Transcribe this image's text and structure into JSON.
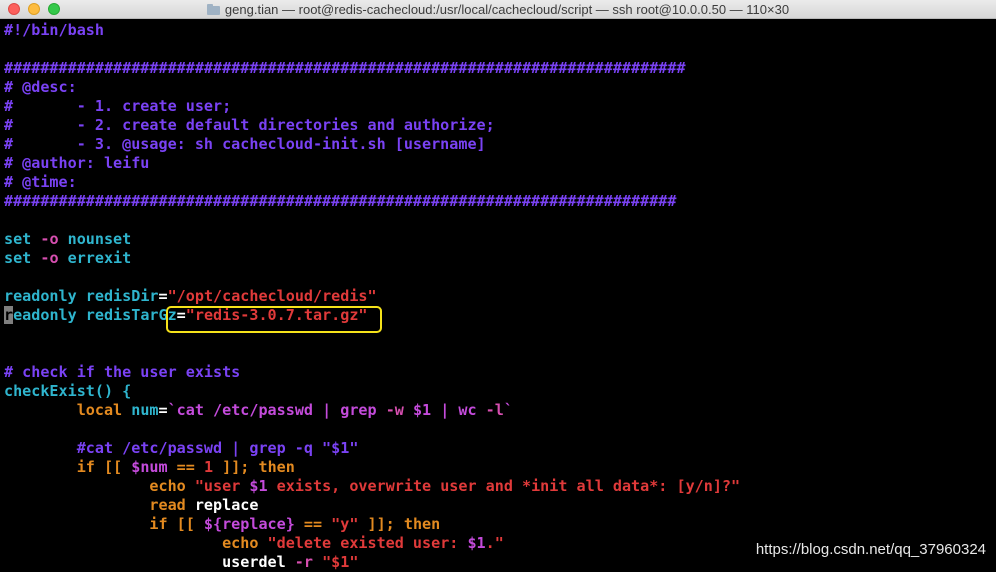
{
  "window": {
    "title": "geng.tian — root@redis-cachecloud:/usr/local/cachecloud/script — ssh root@10.0.0.50 — 110×30"
  },
  "terminal": {
    "lines": [
      [
        {
          "t": "#!/bin/bash",
          "c": "c-comment"
        }
      ],
      [],
      [
        {
          "t": "###########################################################################",
          "c": "c-comment"
        }
      ],
      [
        {
          "t": "# @desc:",
          "c": "c-comment"
        }
      ],
      [
        {
          "t": "#       - 1. create user;",
          "c": "c-comment"
        }
      ],
      [
        {
          "t": "#       - 2. create default directories and authorize;",
          "c": "c-comment"
        }
      ],
      [
        {
          "t": "#       - 3. @usage: sh cachecloud-init.sh [username]",
          "c": "c-comment"
        }
      ],
      [
        {
          "t": "# @author: leifu",
          "c": "c-comment"
        }
      ],
      [
        {
          "t": "# @time:",
          "c": "c-comment"
        }
      ],
      [
        {
          "t": "##########################################################################",
          "c": "c-comment"
        }
      ],
      [],
      [
        {
          "t": "set ",
          "c": "c-kw"
        },
        {
          "t": "-o ",
          "c": "c-opt"
        },
        {
          "t": "nounset",
          "c": "c-kw"
        }
      ],
      [
        {
          "t": "set ",
          "c": "c-kw"
        },
        {
          "t": "-o ",
          "c": "c-opt"
        },
        {
          "t": "errexit",
          "c": "c-kw"
        }
      ],
      [],
      [
        {
          "t": "readonly ",
          "c": "c-kw"
        },
        {
          "t": "redisDir",
          "c": "c-kw"
        },
        {
          "t": "=",
          "c": "c-txt"
        },
        {
          "t": "\"/opt/cachecloud/redis\"",
          "c": "c-str"
        }
      ],
      [
        {
          "t": "r",
          "c": "cursor"
        },
        {
          "t": "eadonly ",
          "c": "c-kw"
        },
        {
          "t": "redisTarGz",
          "c": "c-kw"
        },
        {
          "t": "=",
          "c": "c-txt"
        },
        {
          "t": "\"redis-3.0.7.tar.gz\"",
          "c": "c-str"
        }
      ],
      [],
      [],
      [
        {
          "t": "# check if the user exists",
          "c": "c-comment"
        }
      ],
      [
        {
          "t": "checkExist() {",
          "c": "c-kw"
        }
      ],
      [
        {
          "t": "        local ",
          "c": "c-or"
        },
        {
          "t": "num",
          "c": "c-kw"
        },
        {
          "t": "=",
          "c": "c-txt"
        },
        {
          "t": "`cat /etc/passwd | grep ",
          "c": "c-var"
        },
        {
          "t": "-w ",
          "c": "c-opt"
        },
        {
          "t": "$1",
          "c": "c-var"
        },
        {
          "t": " | wc ",
          "c": "c-var"
        },
        {
          "t": "-l",
          "c": "c-opt"
        },
        {
          "t": "`",
          "c": "c-var"
        }
      ],
      [],
      [
        {
          "t": "        #cat /etc/passwd | grep -q \"$1\"",
          "c": "c-comment"
        }
      ],
      [
        {
          "t": "        if [[ ",
          "c": "c-or"
        },
        {
          "t": "$num",
          "c": "c-var"
        },
        {
          "t": " == ",
          "c": "c-or"
        },
        {
          "t": "1",
          "c": "c-str"
        },
        {
          "t": " ]]; then",
          "c": "c-or"
        }
      ],
      [
        {
          "t": "                echo ",
          "c": "c-or"
        },
        {
          "t": "\"user ",
          "c": "c-str"
        },
        {
          "t": "$1",
          "c": "c-var"
        },
        {
          "t": " exists, overwrite user and *init all data*: [y/n]?\"",
          "c": "c-str"
        }
      ],
      [
        {
          "t": "                read ",
          "c": "c-or"
        },
        {
          "t": "replace",
          "c": "c-txt"
        }
      ],
      [
        {
          "t": "                if [[ ",
          "c": "c-or"
        },
        {
          "t": "${replace}",
          "c": "c-var"
        },
        {
          "t": " == ",
          "c": "c-or"
        },
        {
          "t": "\"y\"",
          "c": "c-str"
        },
        {
          "t": " ]]; then",
          "c": "c-or"
        }
      ],
      [
        {
          "t": "                        echo ",
          "c": "c-or"
        },
        {
          "t": "\"delete existed user: ",
          "c": "c-str"
        },
        {
          "t": "$1",
          "c": "c-var"
        },
        {
          "t": ".\"",
          "c": "c-str"
        }
      ],
      [
        {
          "t": "                        userdel ",
          "c": "c-txt"
        },
        {
          "t": "-r ",
          "c": "c-opt"
        },
        {
          "t": "\"$1\"",
          "c": "c-str"
        }
      ]
    ]
  },
  "watermark": "https://blog.csdn.net/qq_37960324",
  "colors": {
    "comment": "#7a42f4",
    "keyword": "#2fb5ce",
    "option": "#d74fb0",
    "string": "#e03a3a",
    "builtin": "#e38a20",
    "highlight_box": "#f5e21a"
  }
}
